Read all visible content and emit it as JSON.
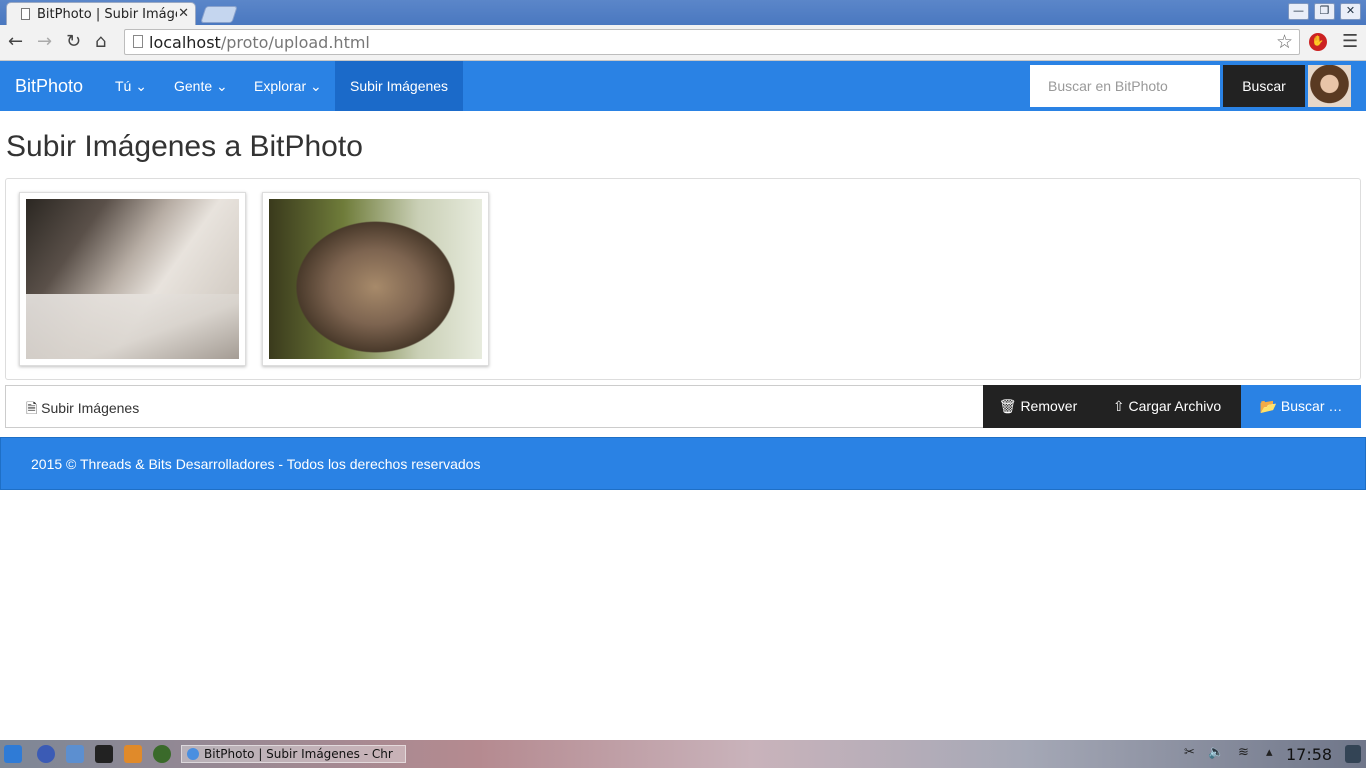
{
  "browser": {
    "tab_title": "BitPhoto | Subir Imágenes",
    "url_host": "localhost",
    "url_path": "/proto/upload.html"
  },
  "navbar": {
    "brand": "BitPhoto",
    "items": [
      {
        "label": "Tú"
      },
      {
        "label": "Gente"
      },
      {
        "label": "Explorar"
      }
    ],
    "active_item": "Subir Imágenes",
    "search_placeholder": "Buscar en BitPhoto",
    "search_button": "Buscar"
  },
  "page": {
    "title": "Subir Imágenes a BitPhoto",
    "file_caption": "Subir Imágenes",
    "buttons": {
      "remove": "Remover",
      "upload": "Cargar Archivo",
      "browse": "Buscar …"
    }
  },
  "footer": {
    "text": "2015 © Threads & Bits Desarrolladores - Todos los derechos reservados"
  },
  "taskbar": {
    "task_label": "BitPhoto | Subir Imágenes - Chr",
    "clock": "17:58"
  },
  "colors": {
    "primary": "#2a82e4",
    "dark": "#222222"
  }
}
